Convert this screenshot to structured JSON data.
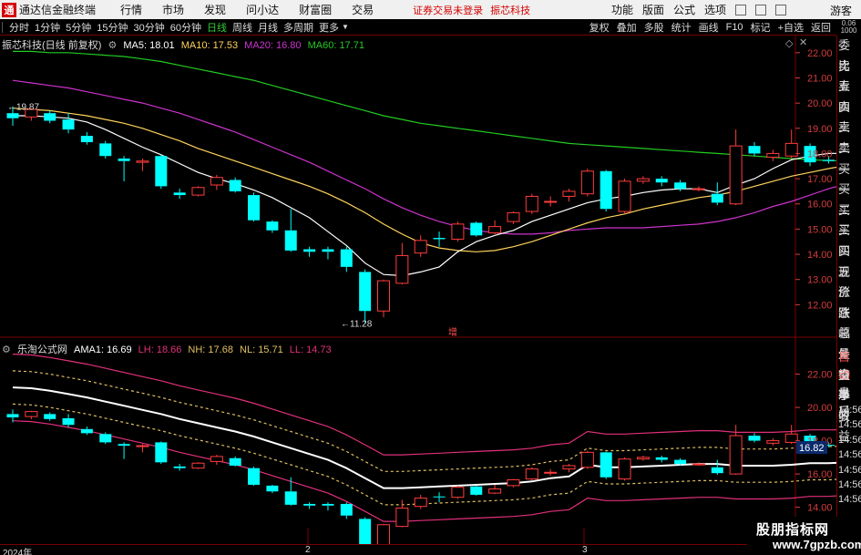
{
  "app": {
    "title": "通达信金融终端",
    "logo_char": "通",
    "menu": [
      "行情",
      "市场",
      "发现",
      "问小达",
      "财富圈",
      "交易"
    ],
    "login_status": "证券交易未登录",
    "stock_name": "振芯科技",
    "right_menu": [
      "功能",
      "版面",
      "公式",
      "选项"
    ],
    "guest": "游客"
  },
  "toolbar": {
    "periods": [
      "分时",
      "1分钟",
      "5分钟",
      "15分钟",
      "30分钟",
      "60分钟",
      "日线",
      "周线",
      "月线",
      "多周期",
      "更多"
    ],
    "active_period": "日线",
    "right_tools": [
      "复权",
      "叠加",
      "多股",
      "统计",
      "画线",
      "F10",
      "标记",
      "+自选",
      "返回"
    ]
  },
  "main_chart": {
    "stock_title": "振芯科技(日线 前复权)",
    "ma5_label": "MA5: 18.01",
    "ma10_label": "MA10: 17.53",
    "ma20_label": "MA20: 16.80",
    "ma60_label": "MA60: 17.71",
    "high_label": "19.87",
    "low_label": "11.28",
    "center_label": "增",
    "y_ticks": [
      "22.00",
      "21.00",
      "20.00",
      "19.00",
      "18.00",
      "17.00",
      "16.00",
      "15.00",
      "14.00",
      "13.00",
      "12.00"
    ],
    "colors": {
      "up": "#ff3c3c",
      "down": "#00ffff",
      "ma5": "#ffffff",
      "ma10": "#ffd25a",
      "ma20": "#cc33cc",
      "ma60": "#22cc22",
      "axis": "#d43c3c"
    }
  },
  "sub_chart": {
    "title": "乐淘公式网",
    "ama_label": "AMA1: 16.69",
    "lh_label": "LH: 18.66",
    "nh_label": "NH: 17.68",
    "nl_label": "NL: 15.71",
    "ll_label": "LL: 14.73",
    "current_value": "16.82",
    "y_ticks": [
      "22.00",
      "20.00",
      "18.00",
      "16.00",
      "14.00"
    ],
    "colors": {
      "ama": "#ffffff",
      "lh": "#e0307a",
      "nh": "#e0c060",
      "nl": "#e0c060",
      "ll": "#e0307a"
    }
  },
  "date_axis": {
    "labels": [
      "2024年",
      "2",
      "3"
    ]
  },
  "quote_panel": {
    "header": "0.06 1000",
    "labels": [
      "委比",
      "卖五",
      "卖四",
      "卖三",
      "卖二",
      "卖一",
      "买一",
      "买二",
      "买三",
      "买四",
      "买五",
      "现价",
      "涨跌",
      "涨幅",
      "总量",
      "外盘",
      "换手",
      "净资",
      "收益"
    ],
    "lower_labels": [
      "自动",
      "交易",
      "盘后"
    ],
    "times": [
      "14:56",
      "14:56",
      "14:56",
      "14:56",
      "14:56",
      "14:56",
      "14:56"
    ]
  },
  "watermark": {
    "line1": "股朋指标网",
    "line2": "www.7gpzb.com"
  },
  "chart_data": {
    "type": "candlestick",
    "title": "振芯科技(日线 前复权)",
    "ylim": [
      11.0,
      22.5
    ],
    "candles": [
      {
        "o": 19.6,
        "c": 19.4,
        "h": 19.87,
        "l": 19.1
      },
      {
        "o": 19.45,
        "c": 19.75,
        "h": 19.8,
        "l": 19.3
      },
      {
        "o": 19.6,
        "c": 19.3,
        "h": 19.7,
        "l": 19.2
      },
      {
        "o": 19.35,
        "c": 18.95,
        "h": 19.6,
        "l": 18.8
      },
      {
        "o": 18.7,
        "c": 18.45,
        "h": 18.85,
        "l": 18.35
      },
      {
        "o": 18.4,
        "c": 17.9,
        "h": 18.5,
        "l": 17.8
      },
      {
        "o": 17.8,
        "c": 17.7,
        "h": 17.9,
        "l": 16.9
      },
      {
        "o": 17.65,
        "c": 17.7,
        "h": 17.8,
        "l": 17.3
      },
      {
        "o": 17.9,
        "c": 16.7,
        "h": 17.95,
        "l": 16.6
      },
      {
        "o": 16.45,
        "c": 16.35,
        "h": 16.6,
        "l": 16.2
      },
      {
        "o": 16.35,
        "c": 16.65,
        "h": 16.7,
        "l": 16.3
      },
      {
        "o": 16.75,
        "c": 17.05,
        "h": 17.15,
        "l": 16.55
      },
      {
        "o": 16.95,
        "c": 16.5,
        "h": 17.05,
        "l": 16.45
      },
      {
        "o": 16.35,
        "c": 15.35,
        "h": 16.45,
        "l": 15.3
      },
      {
        "o": 15.3,
        "c": 14.95,
        "h": 15.35,
        "l": 14.85
      },
      {
        "o": 14.95,
        "c": 14.15,
        "h": 15.8,
        "l": 14.1
      },
      {
        "o": 14.2,
        "c": 14.1,
        "h": 14.3,
        "l": 13.9
      },
      {
        "o": 14.2,
        "c": 14.1,
        "h": 14.3,
        "l": 13.8
      },
      {
        "o": 14.2,
        "c": 13.5,
        "h": 14.3,
        "l": 13.3
      },
      {
        "o": 13.3,
        "c": 11.75,
        "h": 13.4,
        "l": 11.28
      },
      {
        "o": 11.75,
        "c": 12.95,
        "h": 13.0,
        "l": 11.5
      },
      {
        "o": 12.85,
        "c": 13.95,
        "h": 14.45,
        "l": 12.8
      },
      {
        "o": 14.05,
        "c": 14.55,
        "h": 14.75,
        "l": 13.9
      },
      {
        "o": 14.65,
        "c": 14.6,
        "h": 14.9,
        "l": 14.3
      },
      {
        "o": 14.6,
        "c": 15.2,
        "h": 15.3,
        "l": 14.5
      },
      {
        "o": 15.25,
        "c": 14.75,
        "h": 15.3,
        "l": 14.7
      },
      {
        "o": 14.85,
        "c": 15.1,
        "h": 15.35,
        "l": 14.8
      },
      {
        "o": 15.3,
        "c": 15.65,
        "h": 15.7,
        "l": 15.2
      },
      {
        "o": 15.7,
        "c": 16.3,
        "h": 16.4,
        "l": 15.6
      },
      {
        "o": 16.1,
        "c": 16.1,
        "h": 16.3,
        "l": 15.9
      },
      {
        "o": 16.3,
        "c": 16.5,
        "h": 16.6,
        "l": 16.1
      },
      {
        "o": 16.4,
        "c": 17.3,
        "h": 17.4,
        "l": 16.3
      },
      {
        "o": 17.3,
        "c": 15.8,
        "h": 17.35,
        "l": 15.7
      },
      {
        "o": 15.7,
        "c": 16.9,
        "h": 17.0,
        "l": 15.6
      },
      {
        "o": 16.9,
        "c": 17.0,
        "h": 17.1,
        "l": 16.8
      },
      {
        "o": 17.0,
        "c": 16.85,
        "h": 17.1,
        "l": 16.7
      },
      {
        "o": 16.85,
        "c": 16.6,
        "h": 16.95,
        "l": 16.5
      },
      {
        "o": 16.6,
        "c": 16.6,
        "h": 16.7,
        "l": 16.5
      },
      {
        "o": 16.4,
        "c": 16.05,
        "h": 16.85,
        "l": 15.95
      },
      {
        "o": 16.0,
        "c": 18.3,
        "h": 18.95,
        "l": 15.95
      },
      {
        "o": 18.3,
        "c": 18.0,
        "h": 18.45,
        "l": 17.9
      },
      {
        "o": 17.85,
        "c": 18.0,
        "h": 18.15,
        "l": 17.7
      },
      {
        "o": 17.9,
        "c": 18.4,
        "h": 18.95,
        "l": 17.8
      },
      {
        "o": 18.3,
        "c": 17.65,
        "h": 18.4,
        "l": 17.5
      },
      {
        "o": 17.75,
        "c": 17.7,
        "h": 17.9,
        "l": 17.6
      },
      {
        "o": 17.85,
        "c": 18.25,
        "h": 18.3,
        "l": 17.75
      }
    ],
    "ma5": [
      19.5,
      19.5,
      19.45,
      19.4,
      19.25,
      18.95,
      18.6,
      18.25,
      17.95,
      17.6,
      17.25,
      17.0,
      16.8,
      16.55,
      16.25,
      15.85,
      15.45,
      14.9,
      14.35,
      13.65,
      13.2,
      13.15,
      13.3,
      13.5,
      14.1,
      14.5,
      14.75,
      14.95,
      15.3,
      15.55,
      15.8,
      16.05,
      16.2,
      16.3,
      16.45,
      16.55,
      16.6,
      16.6,
      16.45,
      16.75,
      17.0,
      17.4,
      17.75,
      17.9,
      18.0,
      18.01
    ],
    "ma10": [
      19.8,
      19.75,
      19.7,
      19.6,
      19.5,
      19.35,
      19.2,
      19.0,
      18.75,
      18.5,
      18.2,
      17.95,
      17.7,
      17.45,
      17.2,
      16.95,
      16.7,
      16.4,
      16.05,
      15.65,
      15.2,
      14.8,
      14.45,
      14.25,
      14.15,
      14.1,
      14.15,
      14.3,
      14.5,
      14.75,
      15.0,
      15.25,
      15.45,
      15.6,
      15.8,
      15.95,
      16.1,
      16.25,
      16.35,
      16.5,
      16.7,
      16.9,
      17.1,
      17.25,
      17.4,
      17.53
    ],
    "ma20": [
      20.9,
      20.8,
      20.7,
      20.6,
      20.45,
      20.3,
      20.15,
      20.0,
      19.8,
      19.6,
      19.35,
      19.1,
      18.85,
      18.55,
      18.25,
      17.95,
      17.65,
      17.3,
      16.95,
      16.6,
      16.2,
      15.85,
      15.55,
      15.3,
      15.1,
      14.95,
      14.85,
      14.8,
      14.8,
      14.85,
      14.95,
      15.0,
      15.05,
      15.05,
      15.05,
      15.1,
      15.15,
      15.2,
      15.3,
      15.45,
      15.65,
      15.9,
      16.1,
      16.35,
      16.6,
      16.8
    ],
    "ma60": [
      22.05,
      22.05,
      22.0,
      22.0,
      21.95,
      21.9,
      21.85,
      21.75,
      21.65,
      21.5,
      21.35,
      21.2,
      21.05,
      20.9,
      20.7,
      20.5,
      20.3,
      20.1,
      19.9,
      19.7,
      19.5,
      19.35,
      19.2,
      19.1,
      19.0,
      18.9,
      18.8,
      18.7,
      18.6,
      18.5,
      18.4,
      18.35,
      18.3,
      18.25,
      18.2,
      18.15,
      18.1,
      18.05,
      18.0,
      17.95,
      17.9,
      17.85,
      17.8,
      17.75,
      17.72,
      17.71
    ],
    "sub": {
      "ylim": [
        12.5,
        24.0
      ],
      "ama": [
        21.2,
        21.15,
        21.0,
        20.8,
        20.6,
        20.35,
        20.1,
        19.85,
        19.6,
        19.3,
        19.05,
        18.8,
        18.55,
        18.25,
        17.9,
        17.55,
        17.2,
        16.85,
        16.35,
        15.75,
        15.15,
        15.15,
        15.2,
        15.25,
        15.3,
        15.35,
        15.4,
        15.45,
        15.55,
        15.75,
        15.85,
        16.55,
        16.4,
        16.4,
        16.45,
        16.5,
        16.55,
        16.6,
        16.6,
        16.5,
        16.5,
        16.5,
        16.55,
        16.65,
        16.65,
        16.69
      ],
      "lh": [
        23.2,
        23.15,
        23.0,
        22.8,
        22.6,
        22.35,
        22.1,
        21.85,
        21.6,
        21.3,
        21.05,
        20.8,
        20.55,
        20.25,
        19.9,
        19.55,
        19.2,
        18.85,
        18.35,
        17.75,
        17.15,
        17.15,
        17.2,
        17.25,
        17.3,
        17.35,
        17.4,
        17.45,
        17.55,
        17.75,
        17.85,
        18.55,
        18.4,
        18.4,
        18.45,
        18.5,
        18.55,
        18.6,
        18.6,
        18.5,
        18.5,
        18.5,
        18.55,
        18.65,
        18.65,
        18.66
      ],
      "nh": [
        22.2,
        22.15,
        22.0,
        21.8,
        21.6,
        21.35,
        21.1,
        20.85,
        20.6,
        20.3,
        20.05,
        19.8,
        19.55,
        19.25,
        18.9,
        18.55,
        18.2,
        17.85,
        17.35,
        16.75,
        16.15,
        16.15,
        16.2,
        16.25,
        16.3,
        16.35,
        16.4,
        16.45,
        16.55,
        16.75,
        16.85,
        17.55,
        17.4,
        17.4,
        17.45,
        17.5,
        17.55,
        17.6,
        17.6,
        17.5,
        17.5,
        17.5,
        17.55,
        17.65,
        17.65,
        17.68
      ],
      "nl": [
        20.2,
        20.15,
        20.0,
        19.8,
        19.6,
        19.35,
        19.1,
        18.85,
        18.6,
        18.3,
        18.05,
        17.8,
        17.55,
        17.25,
        16.9,
        16.55,
        16.2,
        15.85,
        15.35,
        14.75,
        14.15,
        14.15,
        14.2,
        14.25,
        14.3,
        14.35,
        14.4,
        14.45,
        14.55,
        14.75,
        14.85,
        15.55,
        15.4,
        15.4,
        15.45,
        15.5,
        15.55,
        15.6,
        15.6,
        15.5,
        15.5,
        15.5,
        15.55,
        15.65,
        15.65,
        15.71
      ],
      "ll": [
        19.2,
        19.15,
        19.0,
        18.8,
        18.6,
        18.35,
        18.1,
        17.85,
        17.6,
        17.3,
        17.05,
        16.8,
        16.55,
        16.25,
        15.9,
        15.55,
        15.2,
        14.85,
        14.35,
        13.75,
        13.15,
        13.15,
        13.2,
        13.25,
        13.3,
        13.35,
        13.4,
        13.45,
        13.55,
        13.75,
        13.85,
        14.55,
        14.4,
        14.4,
        14.45,
        14.5,
        14.55,
        14.6,
        14.6,
        14.5,
        14.5,
        14.5,
        14.55,
        14.65,
        14.65,
        14.73
      ]
    }
  }
}
